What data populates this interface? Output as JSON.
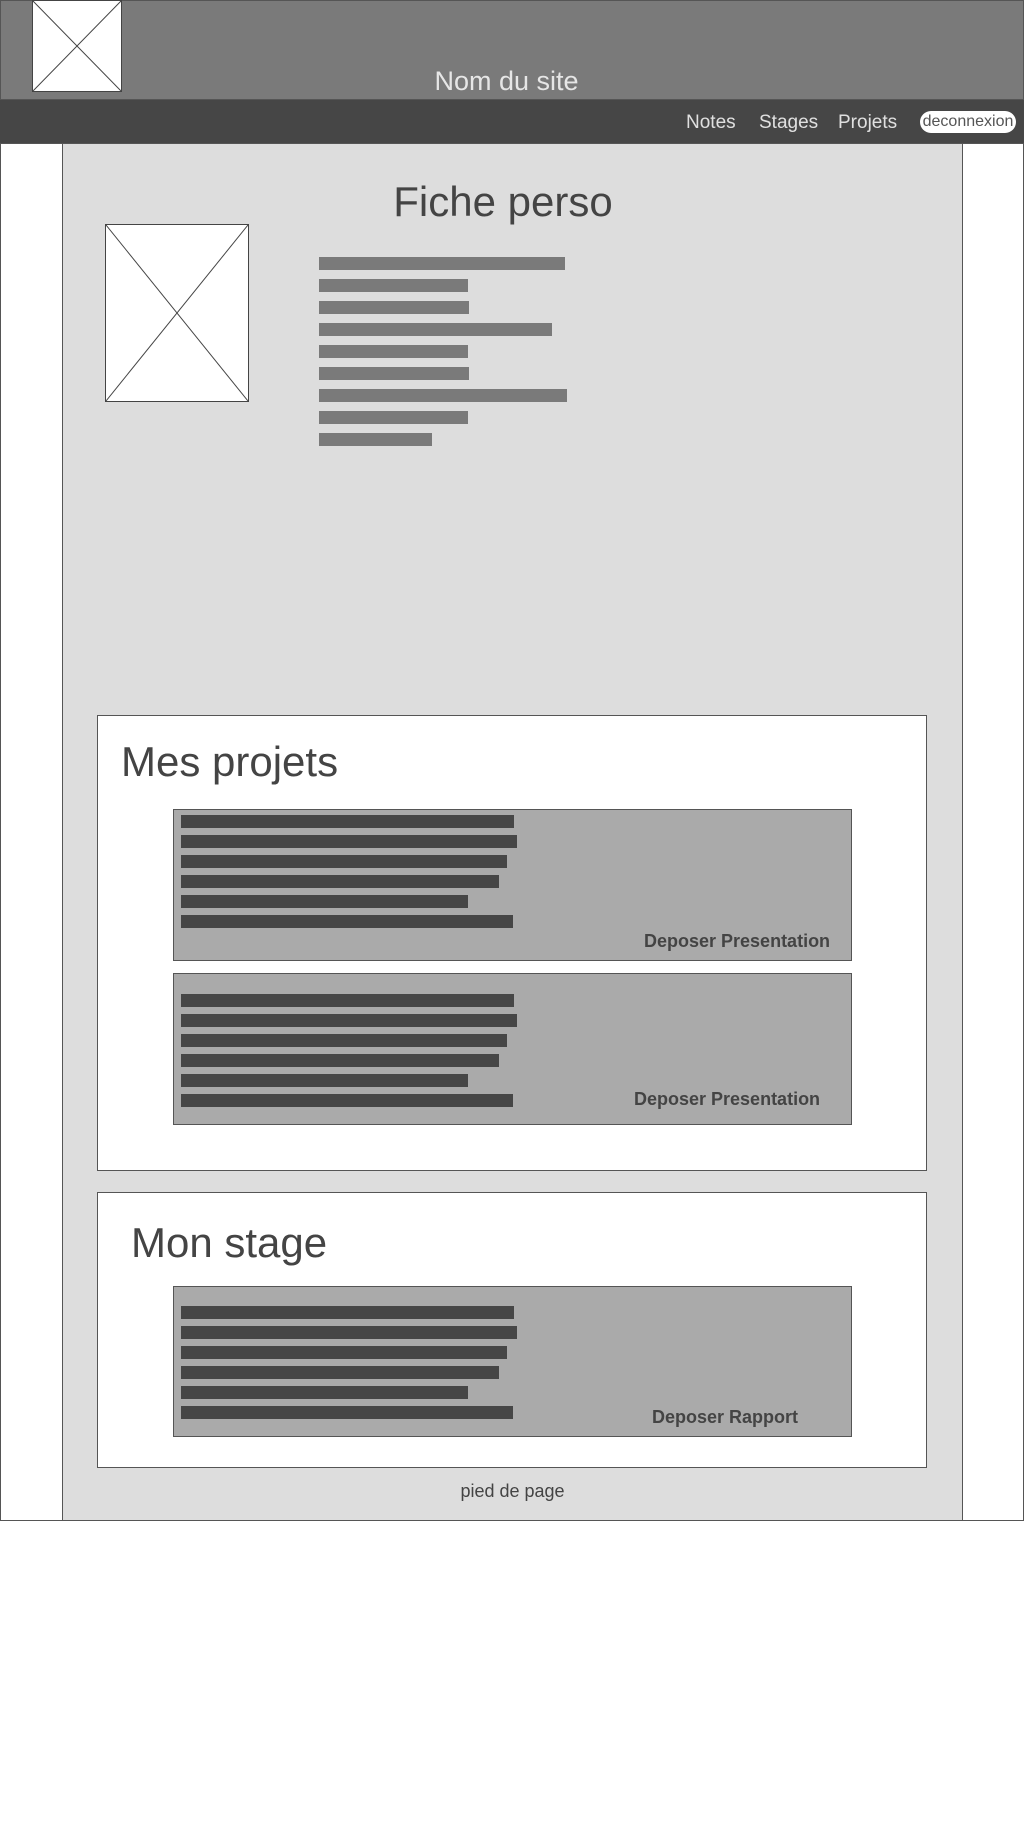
{
  "header": {
    "site_name": "Nom du site",
    "logo_icon": "image-placeholder-icon"
  },
  "nav": {
    "items": [
      "Notes",
      "Stages",
      "Projets"
    ],
    "logout_label": "deconnexion"
  },
  "profile": {
    "title": "Fiche perso",
    "photo_icon": "image-placeholder-icon"
  },
  "projects": {
    "title": "Mes projets",
    "cards": [
      {
        "action_label": "Deposer Presentation"
      },
      {
        "action_label": "Deposer Presentation"
      }
    ]
  },
  "internship": {
    "title": "Mon stage",
    "card": {
      "action_label": "Deposer Rapport"
    }
  },
  "footer": {
    "text": "pied de page"
  },
  "colors": {
    "header_bg": "#7a7a7a",
    "navbar_bg": "#464646",
    "content_bg": "#dddddd",
    "card_bg": "#aaaaaa"
  }
}
